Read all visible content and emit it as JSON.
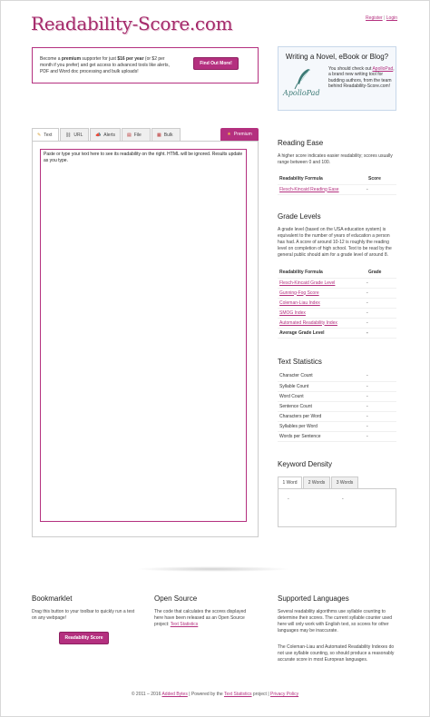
{
  "header": {
    "logo": "Readability-Score.com",
    "register": "Register",
    "separator": "|",
    "login": "Login"
  },
  "promo": {
    "text_1": "Become a ",
    "premium": "premium",
    "text_2": " supporter for just ",
    "price": "$16 per year",
    "text_3": " (or $2 per month if you prefer) and get access to advanced tools like alerts, PDF and Word doc processing and bulk uploads!",
    "button": "Find Out More!"
  },
  "novel": {
    "title": "Writing a Novel, eBook or Blog?",
    "brand": "ApolloPad",
    "text_1": "You should check out ",
    "link": "ApolloPad",
    "text_2": ", a brand new writing tool for budding authors, from the team behind Readability-Score.com!"
  },
  "tabs": [
    {
      "label": "Text",
      "icon": "pencil-icon"
    },
    {
      "label": "URL",
      "icon": "link-icon"
    },
    {
      "label": "Alerts",
      "icon": "megaphone-icon"
    },
    {
      "label": "File",
      "icon": "file-icon"
    },
    {
      "label": "Bulk",
      "icon": "bulk-icon"
    }
  ],
  "premium_tab": "Premium",
  "editor": {
    "text": "Paste or type your text here to see its readability on the right. HTML will be ignored. Results update as you type."
  },
  "reading_ease": {
    "title": "Reading Ease",
    "description": "A higher score indicates easier readability; scores usually range between 0 and 100.",
    "col_formula": "Readability Formula",
    "col_score": "Score",
    "rows": [
      {
        "name": "Flesch-Kincaid Reading Ease",
        "value": "-"
      }
    ]
  },
  "grade_levels": {
    "title": "Grade Levels",
    "description": "A grade level (based on the USA education system) is equivalent to the number of years of education a person has had. A score of around 10-12 is roughly the reading level on completion of high school. Text to be read by the general public should aim for a grade level of around 8.",
    "col_formula": "Readability Formula",
    "col_grade": "Grade",
    "rows": [
      {
        "name": "Flesch-Kincaid Grade Level",
        "value": "-"
      },
      {
        "name": "Gunning-Fog Score",
        "value": "-"
      },
      {
        "name": "Coleman-Liau Index",
        "value": "-"
      },
      {
        "name": "SMOG Index",
        "value": "-"
      },
      {
        "name": "Automated Readability Index",
        "value": "-"
      }
    ],
    "average_label": "Average Grade Level",
    "average_value": "-"
  },
  "text_statistics": {
    "title": "Text Statistics",
    "rows": [
      {
        "name": "Character Count",
        "value": "-"
      },
      {
        "name": "Syllable Count",
        "value": "-"
      },
      {
        "name": "Word Count",
        "value": "-"
      },
      {
        "name": "Sentence Count",
        "value": "-"
      },
      {
        "name": "Characters per Word",
        "value": "-"
      },
      {
        "name": "Syllables per Word",
        "value": "-"
      },
      {
        "name": "Words per Sentence",
        "value": "-"
      }
    ]
  },
  "keyword_density": {
    "title": "Keyword Density",
    "tabs": [
      "1 Word",
      "2 Words",
      "3 Words"
    ],
    "value_1": "-",
    "value_2": "-"
  },
  "footer": {
    "bookmarklet_title": "Bookmarklet",
    "bookmarklet_text": "Drag this button to your toolbar to quickly run a test on any webpage!",
    "bookmarklet_button": "Readability Score",
    "open_source_title": "Open Source",
    "open_source_text": "The code that calculates the scores displayed here have been released as an Open Source project: ",
    "open_source_link": "Text Statistics",
    "languages_title": "Supported Languages",
    "languages_text_1": "Several readability algorithms use syllable counting to determine their scores. The current syllable counter used here will only work with English text, so scores for other languages may be inaccurate.",
    "languages_text_2": "The Coleman-Liau and Automated Readability Indexes do not use syllable counting, so should produce a reasonably accurate score in most European languages.",
    "copyright_1": "© 2011 – 2016 ",
    "added_bytes": "Added Bytes",
    "copyright_2": "  |  Powered by the ",
    "text_statistics": "Text Statistics",
    "copyright_3": " project  |  ",
    "privacy": "Privacy Policy"
  },
  "colors": {
    "brand": "#b4307f",
    "logo": "#a52a6b",
    "novel_bg": "#f5f8fc"
  }
}
